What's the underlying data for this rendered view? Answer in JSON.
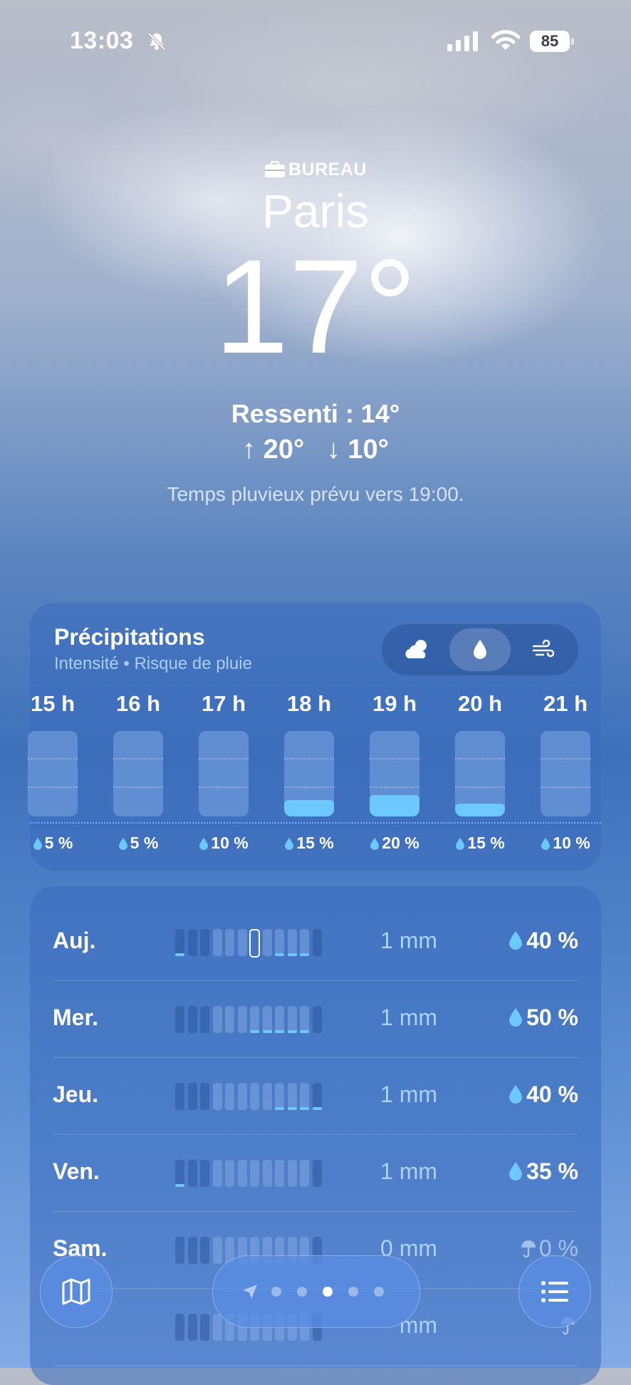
{
  "status": {
    "time": "13:03",
    "battery": "85",
    "icons": [
      "bell-slash-icon",
      "signal-icon",
      "wifi-icon",
      "battery-icon"
    ]
  },
  "location": {
    "label": "BUREAU",
    "icon": "briefcase-icon",
    "city": "Paris",
    "temperature": "17°",
    "feels_like": "Ressenti : 14°",
    "high": "↑ 20°",
    "low": "↓ 10°",
    "forecast": "Temps pluvieux prévu vers 19:00."
  },
  "precipitation": {
    "title": "Précipitations",
    "subtitle": "Intensité • Risque de pluie",
    "modes": [
      "cloud-icon",
      "drop-icon",
      "wind-icon"
    ],
    "selected_mode": "drop-icon",
    "hours": [
      {
        "label": "15 h",
        "chance": "5 %",
        "intensity": 0
      },
      {
        "label": "16 h",
        "chance": "5 %",
        "intensity": 0
      },
      {
        "label": "17 h",
        "chance": "10 %",
        "intensity": 0
      },
      {
        "label": "18 h",
        "chance": "15 %",
        "intensity": 0.15
      },
      {
        "label": "19 h",
        "chance": "20 %",
        "intensity": 0.2
      },
      {
        "label": "20 h",
        "chance": "15 %",
        "intensity": 0.12
      },
      {
        "label": "21 h",
        "chance": "10 %",
        "intensity": 0
      }
    ]
  },
  "daily": [
    {
      "day": "Auj.",
      "amount": "1 mm",
      "chance": "40 %",
      "icon": "drop-icon"
    },
    {
      "day": "Mer.",
      "amount": "1 mm",
      "chance": "50 %",
      "icon": "drop-icon"
    },
    {
      "day": "Jeu.",
      "amount": "1 mm",
      "chance": "40 %",
      "icon": "drop-icon"
    },
    {
      "day": "Ven.",
      "amount": "1 mm",
      "chance": "35 %",
      "icon": "drop-icon"
    },
    {
      "day": "Sam.",
      "amount": "0 mm",
      "chance": "0 %",
      "icon": "umbrella-icon"
    },
    {
      "day": "",
      "amount": "mm",
      "chance": "",
      "icon": "umbrella-icon"
    }
  ],
  "toolbar": {
    "map_icon": "map-icon",
    "list_icon": "list-icon",
    "location_icon": "location-arrow-icon",
    "page_index": 3,
    "page_count": 5
  },
  "colors": {
    "accent_rain": "#6cc8ff",
    "card": "#3a6cbe"
  }
}
